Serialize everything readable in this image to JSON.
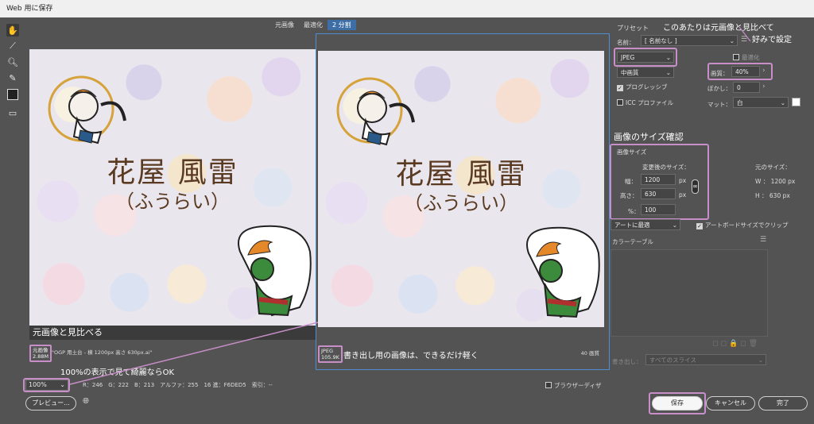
{
  "window": {
    "title": "Web 用に保存"
  },
  "tabs": [
    {
      "label": "元画像",
      "selected": false
    },
    {
      "label": "最適化",
      "selected": false
    },
    {
      "label": "2 分割",
      "selected": true
    }
  ],
  "tools": [
    "hand-icon",
    "slice-select-icon",
    "zoom-icon",
    "eyedropper-icon"
  ],
  "image": {
    "title": "花屋 風雷",
    "subtitle": "（ふうらい）"
  },
  "left_pane": {
    "caption": "元画像と見比べる",
    "badge_line1": "元画像",
    "badge_line2": "2.88M",
    "filename": "\"OGP 用土台 - 横 1200px 高さ 630px.ai\""
  },
  "right_pane": {
    "badge_line1": "JPEG",
    "badge_line2": "105.9K",
    "note": "書き出し用の画像は、できるだけ軽く",
    "colors": "40 画質"
  },
  "notes": {
    "top_right_1": "このあたりは元画像と見比べて",
    "top_right_2": "好みで設定",
    "size_heading": "画像のサイズ確認",
    "zoom_note": "100%の表示で見て綺麗ならOK"
  },
  "preset": {
    "label": "プリセット",
    "name_label": "名前：",
    "name_value": "[ 名前なし ]",
    "format": "JPEG",
    "quality_level": "中画質",
    "optimized_label": "最適化",
    "progressive_label": "プログレッシブ",
    "icc_label": "ICC プロファイル",
    "quality_label": "画質：",
    "quality_value": "40%",
    "blur_label": "ぼかし：",
    "blur_value": "0",
    "matte_label": "マット：",
    "matte_value": "白"
  },
  "image_size": {
    "section": "画像サイズ",
    "new_size_label": "変更後のサイズ：",
    "width_label": "幅：",
    "width_value": "1200",
    "height_label": "高さ：",
    "height_value": "630",
    "percent_label": "%：",
    "percent_value": "100",
    "unit": "px",
    "orig_label": "元のサイズ：",
    "orig_w": "W ： 1200 px",
    "orig_h": "H ： 630 px",
    "fit_value": "アートに最適",
    "clip_label": "アートボードサイズでクリップ"
  },
  "color_table": {
    "label": "カラーテーブル"
  },
  "export": {
    "label": "書き出し：",
    "value": "すべてのスライス"
  },
  "status": {
    "zoom": "100%",
    "readout": "R：246　G：222　B：213　アルファ：255　16 進：F6DED5　索引：--",
    "browser_dither": "ブラウザーディザ"
  },
  "buttons": {
    "preview": "プレビュー...",
    "save": "保存",
    "cancel": "キャンセル",
    "done": "完了"
  },
  "colors": {
    "accent": "#c78ec8",
    "selection": "#4e8fd1",
    "panel": "#535353"
  }
}
